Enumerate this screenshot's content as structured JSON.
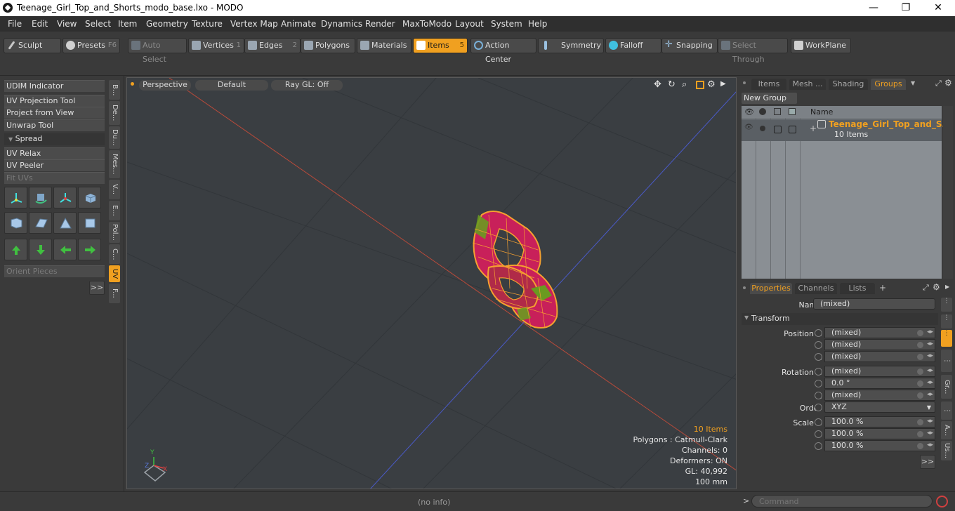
{
  "window": {
    "title": "Teenage_Girl_Top_and_Shorts_modo_base.lxo - MODO",
    "minimize": "—",
    "maximize": "❐",
    "close": "✕"
  },
  "menu": [
    "File",
    "Edit",
    "View",
    "Select",
    "Item",
    "Geometry",
    "Texture",
    "Vertex Map",
    "Animate",
    "Dynamics",
    "Render",
    "MaxToModo",
    "Layout",
    "System",
    "Help"
  ],
  "toolbar": {
    "sculpt": "Sculpt",
    "presets": "Presets",
    "presets_key": "F6",
    "auto_select": "Auto Select",
    "vertices": "Vertices",
    "vertices_key": "1",
    "edges": "Edges",
    "edges_key": "2",
    "polygons": "Polygons",
    "materials": "Materials",
    "items": "Items",
    "items_key": "5",
    "action_center": "Action Center",
    "symmetry": "Symmetry",
    "falloff": "Falloff",
    "snapping": "Snapping",
    "select_through": "Select Through",
    "workplane": "WorkPlane"
  },
  "left": {
    "udim": "UDIM Indicator",
    "uv_projection": "UV Projection Tool",
    "project_from_view": "Project from View",
    "unwrap": "Unwrap Tool",
    "spread": "Spread",
    "uv_relax": "UV Relax",
    "uv_peeler": "UV Peeler",
    "fit_uvs": "Fit UVs",
    "orient_pieces": "Orient Pieces",
    "more": ">>",
    "vtabs": [
      "B...",
      "De...",
      "Du...",
      "Mes...",
      "V...",
      "E...",
      "Pol...",
      "C...",
      "UV",
      "F..."
    ]
  },
  "viewport": {
    "perspective": "Perspective",
    "default": "Default",
    "raygl": "Ray GL: Off",
    "stats": {
      "items": "10 Items",
      "polygons": "Polygons : Catmull-Clark",
      "channels": "Channels: 0",
      "deformers": "Deformers: ON",
      "gl": "GL: 40,992",
      "scale": "100 mm"
    },
    "axis_y": "Y",
    "axis_x": "X",
    "axis_z": "Z"
  },
  "groups": {
    "tabs": [
      "Items",
      "Mesh ...",
      "Shading",
      "Groups"
    ],
    "new_group": "New Group",
    "col_name": "Name",
    "group_name": "Teenage_Girl_Top_and_S...",
    "group_count": "10 Items"
  },
  "properties": {
    "tabs": [
      "Properties",
      "Channels",
      "Lists"
    ],
    "add_tab": "+",
    "name_label": "Name",
    "name_value": "(mixed)",
    "transform": "Transform",
    "position_x_label": "Position X",
    "rotation_x_label": "Rotation X",
    "scale_x_label": "Scale X",
    "y_label": "Y",
    "z_label": "Z",
    "order_label": "Order",
    "order_value": "XYZ",
    "pos_x": "(mixed)",
    "pos_y": "(mixed)",
    "pos_z": "(mixed)",
    "rot_x": "(mixed)",
    "rot_y": "0.0 °",
    "rot_z": "(mixed)",
    "scale_x": "100.0 %",
    "scale_y": "100.0 %",
    "scale_z": "100.0 %",
    "more": ">>",
    "side_tabs": [
      "Gr...",
      "A...",
      "Us..."
    ]
  },
  "status": {
    "info": "(no info)",
    "command_placeholder": "Command",
    "prompt": ">"
  },
  "colors": {
    "accent": "#f0a020",
    "mesh_wire": "#f5a030",
    "mesh_fill": "#c8205a",
    "mesh_green": "#6a9a20"
  }
}
